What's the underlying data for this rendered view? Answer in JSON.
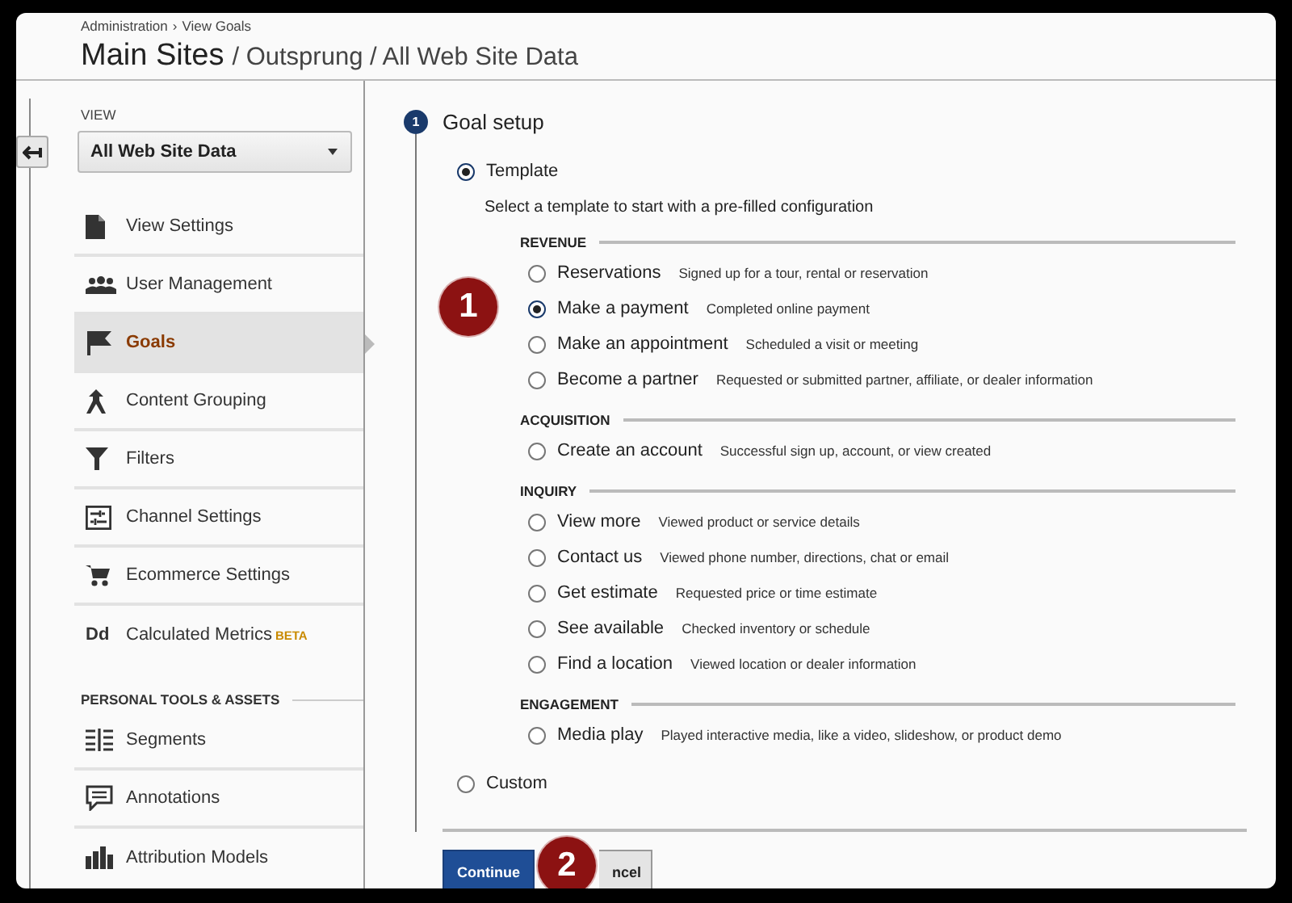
{
  "header": {
    "breadcrumb": [
      "Administration",
      "View Goals"
    ],
    "breadcrumb_separator": "›",
    "title": "Main Sites",
    "path": "/ Outsprung / All Web Site Data"
  },
  "sidebar": {
    "view_label": "VIEW",
    "view_select": {
      "value": "All Web Site Data"
    },
    "items": [
      {
        "label": "View Settings",
        "selected": false
      },
      {
        "label": "User Management",
        "selected": false
      },
      {
        "label": "Goals",
        "selected": true
      },
      {
        "label": "Content Grouping",
        "selected": false
      },
      {
        "label": "Filters",
        "selected": false
      },
      {
        "label": "Channel Settings",
        "selected": false
      },
      {
        "label": "Ecommerce Settings",
        "selected": false
      },
      {
        "label": "Calculated Metrics",
        "selected": false,
        "icon_text": "Dd",
        "badge": "BETA"
      }
    ],
    "personal_heading": "PERSONAL TOOLS & ASSETS",
    "personal_items": [
      {
        "label": "Segments",
        "selected": false
      },
      {
        "label": "Annotations",
        "selected": false
      },
      {
        "label": "Attribution Models",
        "selected": false
      }
    ]
  },
  "goal_setup": {
    "step": "1",
    "title": "Goal setup",
    "template": {
      "label": "Template",
      "selected": true
    },
    "description": "Select a template to start with a pre-filled configuration",
    "groups": [
      {
        "heading": "REVENUE",
        "options": [
          {
            "label": "Reservations",
            "detail": "Signed up for a tour, rental or reservation",
            "selected": false
          },
          {
            "label": "Make a payment",
            "detail": "Completed online payment",
            "selected": true
          },
          {
            "label": "Make an appointment",
            "detail": "Scheduled a visit or meeting",
            "selected": false
          },
          {
            "label": "Become a partner",
            "detail": "Requested or submitted partner, affiliate, or dealer information",
            "selected": false
          }
        ]
      },
      {
        "heading": "ACQUISITION",
        "options": [
          {
            "label": "Create an account",
            "detail": "Successful sign up, account, or view created",
            "selected": false
          }
        ]
      },
      {
        "heading": "INQUIRY",
        "options": [
          {
            "label": "View more",
            "detail": "Viewed product or service details",
            "selected": false
          },
          {
            "label": "Contact us",
            "detail": "Viewed phone number, directions, chat or email",
            "selected": false
          },
          {
            "label": "Get estimate",
            "detail": "Requested price or time estimate",
            "selected": false
          },
          {
            "label": "See available",
            "detail": "Checked inventory or schedule",
            "selected": false
          },
          {
            "label": "Find a location",
            "detail": "Viewed location or dealer information",
            "selected": false
          }
        ]
      },
      {
        "heading": "ENGAGEMENT",
        "options": [
          {
            "label": "Media play",
            "detail": "Played interactive media, like a video, slideshow, or product demo",
            "selected": false
          }
        ]
      }
    ],
    "custom": {
      "label": "Custom",
      "selected": false
    },
    "buttons": [
      {
        "kind": "primary",
        "label": "Continue"
      },
      {
        "kind": "secondary",
        "label": "ncel"
      }
    ]
  },
  "callouts": [
    {
      "label": "1"
    },
    {
      "label": "2"
    }
  ]
}
